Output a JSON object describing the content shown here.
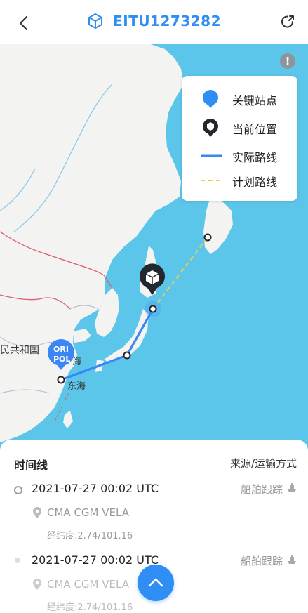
{
  "header": {
    "title": "EITU1273282",
    "back_icon": "chevron-left-icon",
    "title_icon": "container-box-icon",
    "share_icon": "external-link-icon"
  },
  "map": {
    "info_icon": "info-icon",
    "info_symbol": "!",
    "labels": {
      "country": "民共和国",
      "port_origin": "ORI",
      "port_pol": "POL",
      "city_shanghai": "海",
      "east_sea": "东海"
    },
    "legend": {
      "items": [
        {
          "label": "关键站点",
          "symbol": "key-station-pin-icon"
        },
        {
          "label": "当前位置",
          "symbol": "current-location-pin-icon"
        },
        {
          "label": "实际路线",
          "symbol": "actual-route-line"
        },
        {
          "label": "计划路线",
          "symbol": "planned-route-dashed-line"
        }
      ]
    },
    "colors": {
      "sea": "#5cc6ea",
      "land": "#f3f3f1",
      "route_actual": "#3b86f5",
      "route_planned": "#f1cf4a",
      "border": "#e05a6a"
    }
  },
  "timeline": {
    "title": "时间线",
    "source_header": "来源/运输方式",
    "entries": [
      {
        "time": "2021-07-27 00:02 UTC",
        "source": "船舶跟踪",
        "vessel": "CMA CGM VELA",
        "coords": "经纬度:2.74/101.16"
      },
      {
        "time": "2021-07-27 00:02 UTC",
        "source": "船舶跟踪",
        "vessel": "CMA CGM VELA",
        "coords": "经纬度:2.74/101.16"
      }
    ]
  },
  "scroll_up_icon": "chevron-up-icon"
}
